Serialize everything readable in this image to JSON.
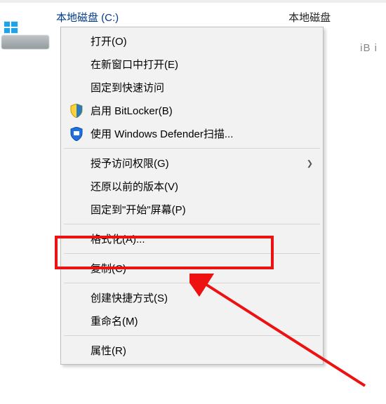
{
  "drive": {
    "label_left": "本地磁盘 (C:)",
    "label_right": "本地磁盘",
    "partial_text": "iB i"
  },
  "menu": {
    "open": "打开(O)",
    "open_new_window": "在新窗口中打开(E)",
    "pin_quick_access": "固定到快速访问",
    "bitlocker": "启用 BitLocker(B)",
    "defender": "使用 Windows Defender扫描...",
    "grant_access": "授予访问权限(G)",
    "restore_previous": "还原以前的版本(V)",
    "pin_start": "固定到\"开始\"屏幕(P)",
    "format": "格式化(A)...",
    "copy": "复制(C)",
    "create_shortcut": "创建快捷方式(S)",
    "rename": "重命名(M)",
    "properties": "属性(R)"
  }
}
